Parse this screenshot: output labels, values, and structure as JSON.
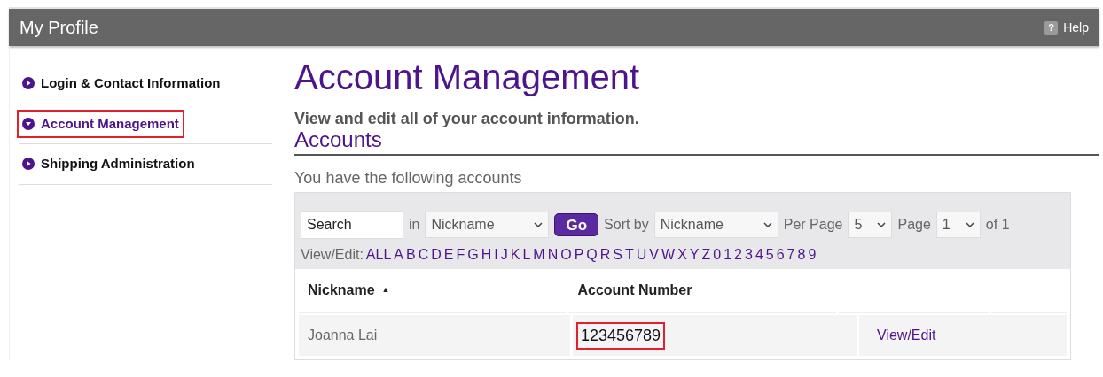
{
  "header": {
    "title": "My Profile",
    "help": {
      "icon": "?",
      "label": "Help"
    }
  },
  "sidebar": {
    "items": [
      {
        "label": "Login & Contact Information",
        "selected": false,
        "highlighted": false
      },
      {
        "label": "Account Management",
        "selected": true,
        "highlighted": true
      },
      {
        "label": "Shipping Administration",
        "selected": false,
        "highlighted": false
      }
    ]
  },
  "main": {
    "title": "Account Management",
    "subtitle": "View and edit all of your account information.",
    "section": "Accounts",
    "intro": "You have the following accounts",
    "toolbar": {
      "search": {
        "value": "Search"
      },
      "in_label": "in",
      "search_field": "Nickname",
      "go": "Go",
      "sort_label": "Sort by",
      "sort_field": "Nickname",
      "per_page_label": "Per Page",
      "per_page": "5",
      "page_label": "Page",
      "page": "1",
      "of_label": "of 1"
    },
    "filter": {
      "label": "View/Edit:",
      "letters": [
        "ALL",
        "A",
        "B",
        "C",
        "D",
        "E",
        "F",
        "G",
        "H",
        "I",
        "J",
        "K",
        "L",
        "M",
        "N",
        "O",
        "P",
        "Q",
        "R",
        "S",
        "T",
        "U",
        "V",
        "W",
        "X",
        "Y",
        "Z",
        "0",
        "1",
        "2",
        "3",
        "4",
        "5",
        "6",
        "7",
        "8",
        "9"
      ]
    },
    "table": {
      "columns": [
        {
          "label": "Nickname",
          "sort_indicator": "▲"
        },
        {
          "label": "Account Number"
        }
      ],
      "rows": [
        {
          "nickname": "Joanna Lai",
          "account_number": "123456789",
          "account_highlighted": true,
          "action": "View/Edit"
        }
      ]
    }
  }
}
